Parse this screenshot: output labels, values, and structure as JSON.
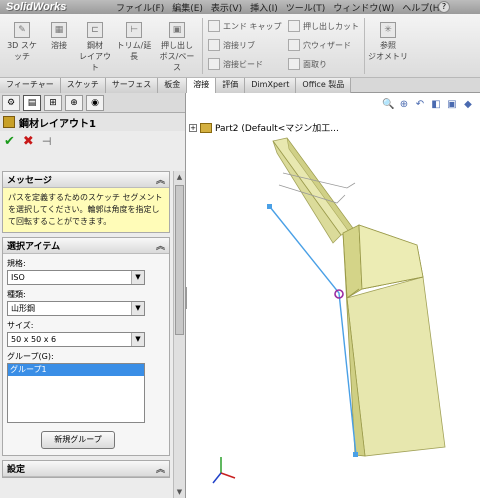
{
  "app": {
    "logo": "SolidWorks"
  },
  "menu": [
    "ファイル(F)",
    "編集(E)",
    "表示(V)",
    "挿入(I)",
    "ツール(T)",
    "ウィンドウ(W)",
    "ヘルプ(H)"
  ],
  "toolbar": {
    "sketch3d": "3D スケッチ",
    "weld": "溶接",
    "structural_line1": "鋼材",
    "structural_line2": "レイアウト",
    "trim_line1": "トリム/延",
    "trim_line2": "長",
    "extrude_line1": "押し出し",
    "extrude_line2": "ボス/ベース",
    "end_cap": "エンド キャップ",
    "gusset": "溶接リブ",
    "weld_bead": "溶接ビード",
    "cut_extrude": "押し出しカット",
    "hole_wizard": "穴ウィザード",
    "chamfer": "面取り",
    "ref_geom_line1": "参照",
    "ref_geom_line2": "ジオメトリ"
  },
  "command_tabs": [
    "フィーチャー",
    "スケッチ",
    "サーフェス",
    "板金",
    "溶接",
    "評価",
    "DimXpert",
    "Office 製品"
  ],
  "active_command_tab": "溶接",
  "property_manager": {
    "title": "鋼材レイアウト1",
    "message_group": {
      "title": "メッセージ",
      "text": "パスを定義するためのスケッチ セグメントを選択してください。輪郭は角度を指定して回転することができます。"
    },
    "selection_group": {
      "title": "選択アイテム",
      "standard_label": "規格:",
      "standard_value": "ISO",
      "type_label": "種類:",
      "type_value": "山形鋼",
      "size_label": "サイズ:",
      "size_value": "50 x 50 x 6",
      "groups_label": "グループ(G):",
      "groups_items": [
        "グループ1"
      ],
      "new_group_button": "新規グループ"
    },
    "settings_group": {
      "title": "設定"
    }
  },
  "feature_tree": {
    "part_label": "Part2  (Default<マジン加工..."
  },
  "colors": {
    "profile_fill": "#e6e6a8",
    "profile_stroke": "#9a9a4a",
    "path_line": "#4aa0e6",
    "accent": "#3a8ee6"
  }
}
